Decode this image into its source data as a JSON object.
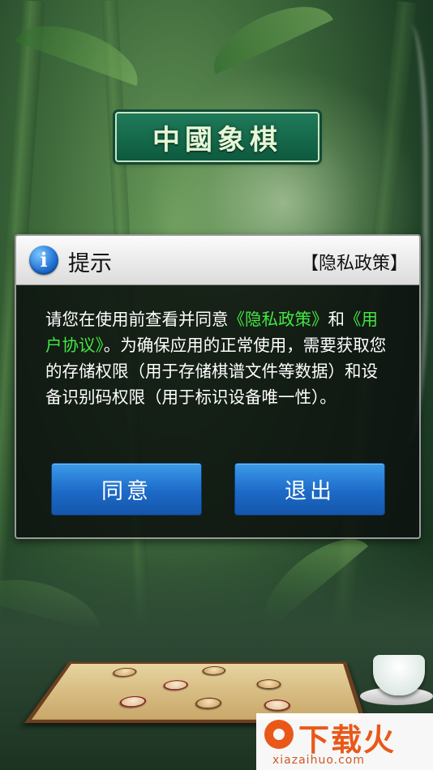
{
  "logo": {
    "text": "中國象棋"
  },
  "dialog": {
    "icon": "info-icon",
    "title": "提示",
    "privacy_link": "【隐私政策】",
    "body": {
      "p1": "请您在使用前查看并同意",
      "privacy_link": "《隐私政策》",
      "p2": "和",
      "terms_link": "《用户协议》",
      "p3": "。为确保应用的正常使用，需要获取您的存储权限（用于存储棋谱文件等数据）和设备识别码权限（用于标识设备唯一性）。"
    },
    "agree_button": "同意",
    "exit_button": "退出"
  },
  "watermark": {
    "title": "下载火",
    "url": "xiazaihuo.com"
  },
  "colors": {
    "link_green": "#43e643",
    "button_blue": "#1c6ac8",
    "watermark_orange": "#f25a1a"
  }
}
